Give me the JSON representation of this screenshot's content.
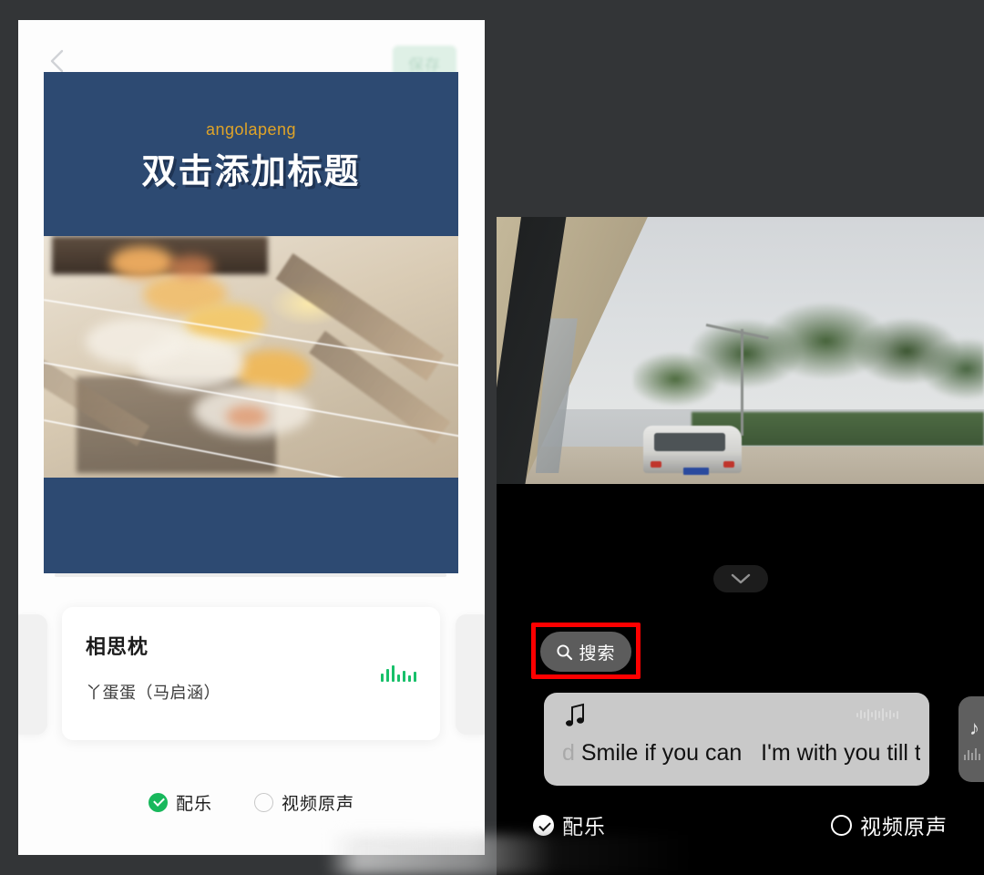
{
  "left_panel": {
    "back_icon": "chevron-left-icon",
    "save_label": "保存",
    "preview": {
      "subtitle": "angolapeng",
      "title": "双击添加标题",
      "photo_alt": "grilled-skewers-photo",
      "band_color": "#2d4a72",
      "subtitle_color": "#e0a428"
    },
    "music_card": {
      "song_title": "相思枕",
      "artist": "丫蛋蛋（马启涵）",
      "wave_icon": "audio-wave-icon",
      "wave_color": "#18c06a"
    },
    "audio_options": [
      {
        "label": "配乐",
        "selected": true
      },
      {
        "label": "视频原声",
        "selected": false
      }
    ],
    "accent_color": "#18b85c"
  },
  "right_panel": {
    "video_alt": "car-window-road-van-photo",
    "collapse_icon": "chevron-down-icon",
    "search": {
      "icon": "search-icon",
      "label": "搜索",
      "highlight_color": "#fe0000"
    },
    "music_card": {
      "note_icon": "music-note-icon",
      "wave_icon": "audio-wave-icon",
      "lyric_primary": "Smile if you can",
      "lyric_secondary": "I'm with you till t",
      "lyric_left_fragment": "d"
    },
    "audio_options": [
      {
        "label": "配乐",
        "selected": true
      },
      {
        "label": "视频原声",
        "selected": false
      }
    ]
  }
}
